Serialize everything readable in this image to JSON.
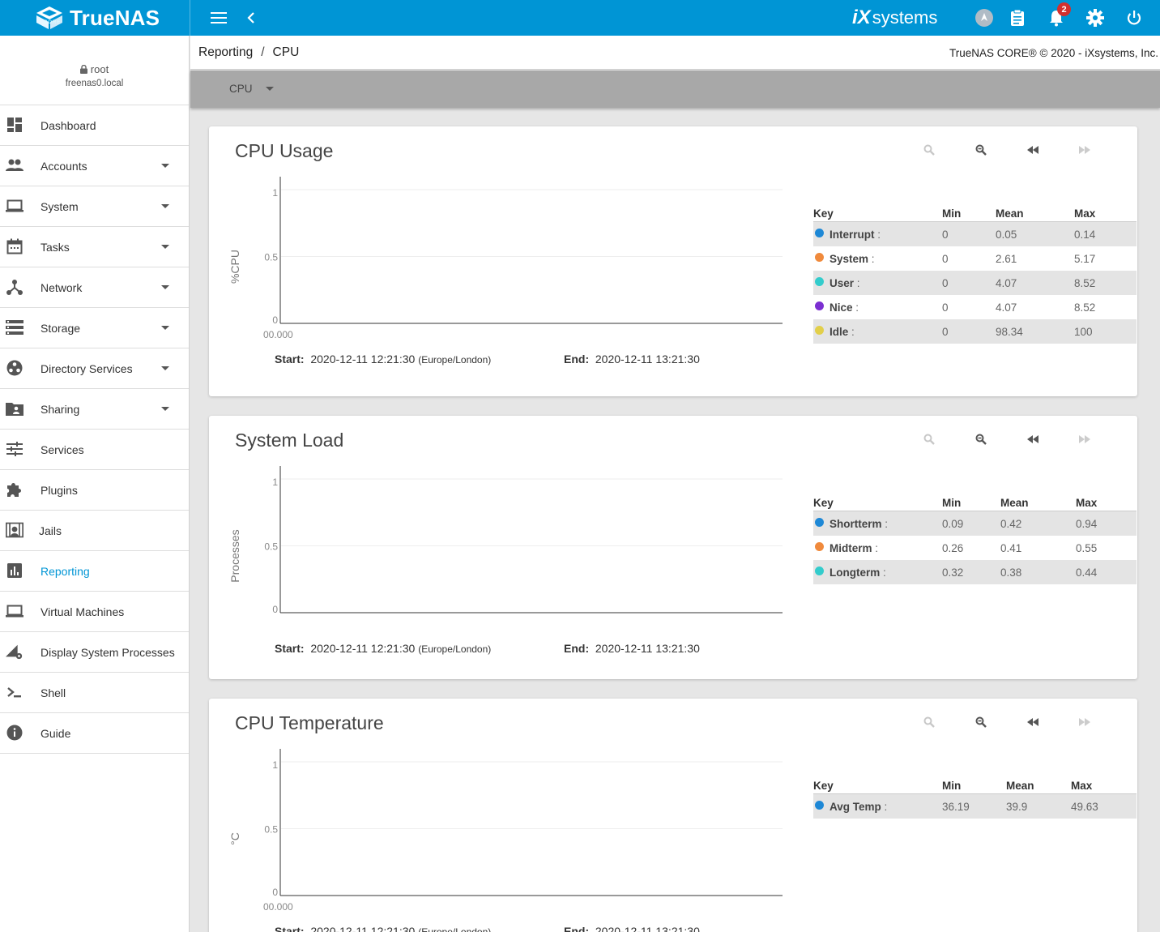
{
  "topbar": {
    "brand": "TrueNAS",
    "brand_sub": "CORE",
    "vendor": "iXsystems",
    "vendor_ix": "iX",
    "vendor_rest": "systems",
    "notification_count": "2",
    "icons": [
      "menu-icon",
      "chevron-left-icon",
      "truecommand-icon",
      "clipboard-icon",
      "bell-icon",
      "gear-icon",
      "power-icon"
    ]
  },
  "user": {
    "name": "root",
    "host": "freenas0.local"
  },
  "sidebar": {
    "items": [
      {
        "label": "Dashboard",
        "icon": "dashboard-icon",
        "caret": false
      },
      {
        "label": "Accounts",
        "icon": "accounts-icon",
        "caret": true
      },
      {
        "label": "System",
        "icon": "laptop-icon",
        "caret": true
      },
      {
        "label": "Tasks",
        "icon": "calendar-icon",
        "caret": true
      },
      {
        "label": "Network",
        "icon": "network-icon",
        "caret": true
      },
      {
        "label": "Storage",
        "icon": "storage-icon",
        "caret": true
      },
      {
        "label": "Directory Services",
        "icon": "directory-icon",
        "caret": true
      },
      {
        "label": "Sharing",
        "icon": "folder-shared-icon",
        "caret": true
      },
      {
        "label": "Services",
        "icon": "tune-icon",
        "caret": false
      },
      {
        "label": "Plugins",
        "icon": "puzzle-icon",
        "caret": false
      },
      {
        "label": "Jails",
        "icon": "jail-icon",
        "caret": false
      },
      {
        "label": "Reporting",
        "icon": "chart-icon",
        "caret": false,
        "active": true
      },
      {
        "label": "Virtual Machines",
        "icon": "laptop-icon",
        "caret": false
      },
      {
        "label": "Display System Processes",
        "icon": "processes-icon",
        "caret": false
      },
      {
        "label": "Shell",
        "icon": "terminal-icon",
        "caret": false
      },
      {
        "label": "Guide",
        "icon": "info-icon",
        "caret": false
      }
    ]
  },
  "breadcrumb": {
    "parent": "Reporting",
    "sep": "/",
    "current": "CPU"
  },
  "copyright": "TrueNAS CORE® © 2020 - iXsystems, Inc.",
  "toolbar": {
    "selected": "CPU"
  },
  "range": {
    "start_label": "Start:",
    "start_value": "2020-12-11 12:21:30",
    "start_tz": "(Europe/London)",
    "end_label": "End:",
    "end_value": "2020-12-11 13:21:30"
  },
  "legend_headers": {
    "key": "Key",
    "min": "Min",
    "mean": "Mean",
    "max": "Max"
  },
  "cards": [
    {
      "title": "CPU Usage",
      "ylabel": "%CPU",
      "xtick": "00.000",
      "yticks": [
        "1",
        "0.5",
        "0"
      ],
      "legend": [
        {
          "name": "Interrupt",
          "min": "0",
          "mean": "0.05",
          "max": "0.14",
          "color": "#1e88d6"
        },
        {
          "name": "System",
          "min": "0",
          "mean": "2.61",
          "max": "5.17",
          "color": "#f08a3c"
        },
        {
          "name": "User",
          "min": "0",
          "mean": "4.07",
          "max": "8.52",
          "color": "#33cccc"
        },
        {
          "name": "Nice",
          "min": "0",
          "mean": "4.07",
          "max": "8.52",
          "color": "#7b2fd1"
        },
        {
          "name": "Idle",
          "min": "0",
          "mean": "98.34",
          "max": "100",
          "color": "#e2cf4a"
        }
      ]
    },
    {
      "title": "System Load",
      "ylabel": "Processes",
      "xtick": "",
      "yticks": [
        "1",
        "0.5",
        "0"
      ],
      "legend": [
        {
          "name": "Shortterm",
          "min": "0.09",
          "mean": "0.42",
          "max": "0.94",
          "color": "#1e88d6"
        },
        {
          "name": "Midterm",
          "min": "0.26",
          "mean": "0.41",
          "max": "0.55",
          "color": "#f08a3c"
        },
        {
          "name": "Longterm",
          "min": "0.32",
          "mean": "0.38",
          "max": "0.44",
          "color": "#33cccc"
        }
      ]
    },
    {
      "title": "CPU Temperature",
      "ylabel": "°C",
      "xtick": "00.000",
      "yticks": [
        "1",
        "0.5",
        "0"
      ],
      "legend": [
        {
          "name": "Avg Temp",
          "min": "36.19",
          "mean": "39.9",
          "max": "49.63",
          "color": "#1e88d6"
        }
      ]
    }
  ]
}
